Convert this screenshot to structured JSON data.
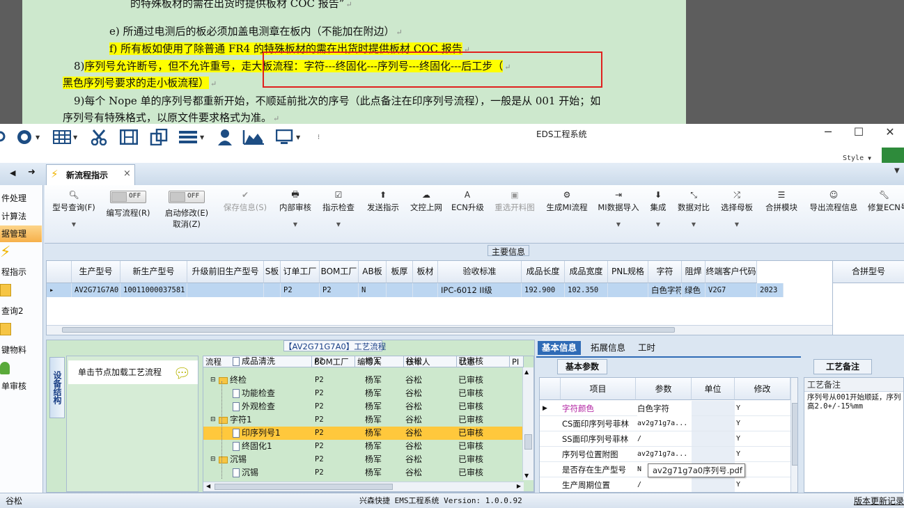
{
  "document": {
    "line1": "的特殊板材的需在出货时提供板材 COC 报告”",
    "line_e": "e)  所通过电测后的板必须加盖电测章在板内（不能加在附边）",
    "line_f": "f)  所有板如使用了除普通 FR4 的特殊板材的需在出货时提供板材 COC 报告",
    "line8_num": "8)",
    "line8_text": "序列号允许断号，但不允许重号，走大板流程：字符---终固化---序列号---终固化---后工步（",
    "line8_cont": "黑色序列号要求的走小板流程）",
    "line9": "9)每个 Nope 单的序列号都重新开始，不顺延前批次的序号（此点备注在印序列号流程），一般是从 001 开始；如",
    "line9_cont": "序列号有特殊格式，以原文件要求格式为准。",
    "para_mark": "↵"
  },
  "window": {
    "title": "EDS工程系统",
    "min": "─",
    "max": "☐",
    "close": "✕",
    "style_label": "Style"
  },
  "nav": {
    "back": "◀",
    "forward": "➜",
    "tab_label": "新流程指示",
    "tab_close": "×"
  },
  "sidebar": {
    "items": [
      "件处理",
      "计算法",
      "据管理",
      "程指示",
      "查询2",
      "键物料",
      "单审核"
    ]
  },
  "ribbon": {
    "query": "型号查询(F)",
    "edit_flow": "编写流程(R)",
    "toggle_off": "OFF",
    "start_edit": "启动修改(E)",
    "cancel": "取消(Z)",
    "save": "保存信息(S)",
    "internal_review": "内部审核",
    "check": "指示检查",
    "send": "发送指示",
    "upload": "文控上网",
    "ecn": "ECN升级",
    "regen_chart": "重选开料图",
    "gen_mi": "生成MI流程",
    "mi_import": "MI数据导入",
    "integrate": "集成",
    "compare": "数据对比",
    "select_master": "选择母板",
    "merge": "合拼模块",
    "export": "导出流程信息",
    "fix_ecn": "修复ECN号"
  },
  "main_info": {
    "header": "主要信息",
    "columns": [
      "生产型号",
      "新生产型号",
      "升级前旧生产型号",
      "S板",
      "订单工厂",
      "BOM工厂",
      "AB板",
      "板厚",
      "板材",
      "验收标准",
      "成品长度",
      "成品宽度",
      "PNL规格",
      "字符",
      "阻焊",
      "终端客户代码"
    ],
    "row": [
      "AV2G71G7A0",
      "10011000037581",
      "",
      "",
      "P2",
      "P2",
      "N",
      "",
      "",
      "IPC-6012 II级",
      "192.900",
      "102.350",
      "",
      "白色字符",
      "绿色",
      "V2G7",
      "2023"
    ],
    "merge_col": "合拼型号"
  },
  "process": {
    "title": "【AV2G71G7A0】工艺流程",
    "side_tab": "设备结构",
    "node_hint": "单击节点加载工艺流程",
    "columns": [
      "流程",
      "BOM工厂",
      "编写人",
      "核审人",
      "状态",
      "PI"
    ],
    "rows": [
      {
        "name": "成品清洗",
        "bom": "P2",
        "writer": "杨军",
        "reviewer": "谷松",
        "status": "已审核"
      },
      {
        "name": "终检",
        "bom": "P2",
        "writer": "杨军",
        "reviewer": "谷松",
        "status": "已审核"
      },
      {
        "name": "功能检查",
        "bom": "P2",
        "writer": "杨军",
        "reviewer": "谷松",
        "status": "已审核"
      },
      {
        "name": "外观检查",
        "bom": "P2",
        "writer": "杨军",
        "reviewer": "谷松",
        "status": "已审核"
      },
      {
        "name": "字符1",
        "bom": "P2",
        "writer": "杨军",
        "reviewer": "谷松",
        "status": "已审核"
      },
      {
        "name": "印序列号1",
        "bom": "P2",
        "writer": "杨军",
        "reviewer": "谷松",
        "status": "已审核"
      },
      {
        "name": "终固化1",
        "bom": "P2",
        "writer": "杨军",
        "reviewer": "谷松",
        "status": "已审核"
      },
      {
        "name": "沉锡",
        "bom": "P2",
        "writer": "杨军",
        "reviewer": "谷松",
        "status": "已审核"
      },
      {
        "name": "沉锡",
        "bom": "P2",
        "writer": "杨军",
        "reviewer": "谷松",
        "status": "已审核"
      }
    ]
  },
  "basic_info": {
    "tabs": [
      "基本信息",
      "拓展信息",
      "工时"
    ],
    "subtab": "基本参数",
    "columns": [
      "项目",
      "参数",
      "单位",
      "修改"
    ],
    "rows": [
      {
        "item": "字符颜色",
        "param": "白色字符",
        "unit": "",
        "mod": "Y"
      },
      {
        "item": "CS面印序列号菲林",
        "param": "av2g71g7a...",
        "unit": "",
        "mod": "Y"
      },
      {
        "item": "SS面印序列号菲林",
        "param": "/",
        "unit": "",
        "mod": "Y"
      },
      {
        "item": "序列号位置附图",
        "param": "av2g71g7a...",
        "unit": "",
        "mod": "Y"
      },
      {
        "item": "是否存在生产型号",
        "param": "N",
        "unit": "",
        "mod": "Y"
      },
      {
        "item": "生产周期位置",
        "param": "/",
        "unit": "",
        "mod": "Y"
      }
    ],
    "tooltip": "av2g71g7a0序列号.pdf",
    "highlight_color": "#b01fa0"
  },
  "remark": {
    "tab": "工艺备注",
    "header": "工艺备注",
    "line1": "序列号从001开始顺延，序列",
    "line2": "高2.0+/-15%mm"
  },
  "status": {
    "user": "谷松",
    "version": "兴森快捷 EMS工程系统 Version: 1.0.0.92",
    "update_log": "版本更新记录"
  }
}
